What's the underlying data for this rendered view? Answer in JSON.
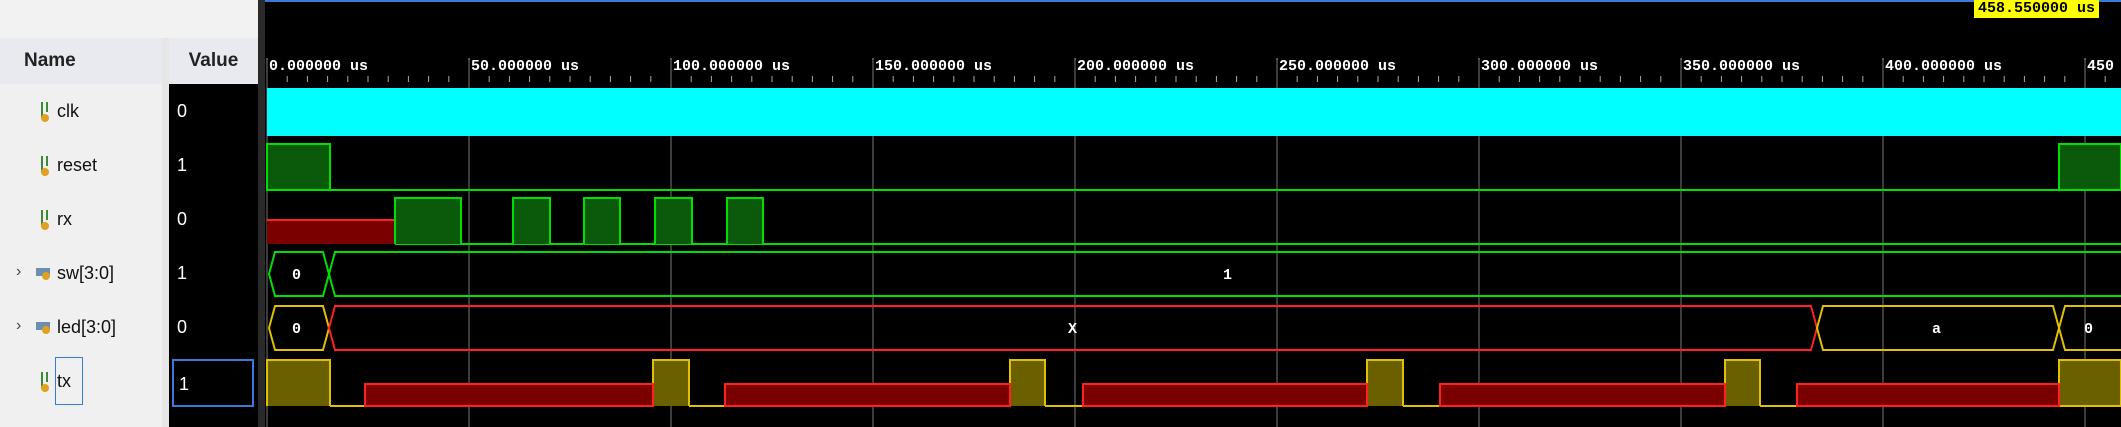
{
  "cursor": {
    "time_label": "458.550000 us"
  },
  "columns": {
    "name_header": "Name",
    "value_header": "Value"
  },
  "signals": [
    {
      "name": "clk",
      "value": "0",
      "icon": "bit-signal-icon",
      "expandable": false
    },
    {
      "name": "reset",
      "value": "1",
      "icon": "bit-signal-icon",
      "expandable": false
    },
    {
      "name": "rx",
      "value": "0",
      "icon": "bit-signal-icon",
      "expandable": false
    },
    {
      "name": "sw[3:0]",
      "value": "1",
      "icon": "bus-signal-icon",
      "expandable": true
    },
    {
      "name": "led[3:0]",
      "value": "0",
      "icon": "bus-signal-icon",
      "expandable": true
    },
    {
      "name": "tx",
      "value": "1",
      "icon": "bit-signal-icon",
      "expandable": false,
      "selected": true
    }
  ],
  "timeline": {
    "unit": "us",
    "tick_labels": [
      "0.000000 us",
      "50.000000 us",
      "100.000000 us",
      "150.000000 us",
      "200.000000 us",
      "250.000000 us",
      "300.000000 us",
      "350.000000 us",
      "400.000000 us",
      "450"
    ]
  },
  "waveforms": {
    "sw": {
      "segments": [
        "0",
        "1"
      ]
    },
    "led": {
      "segments": [
        "0",
        "X",
        "a",
        "0"
      ]
    }
  },
  "colors": {
    "clk": "#00ffff",
    "high_green": "#0b5a0b",
    "line_green": "#00e000",
    "unknown_red": "#7a0000",
    "line_red": "#ff2020",
    "tx_yellow": "#6b6000",
    "line_yellow": "#e0c000",
    "selection": "#3a7bd5",
    "cursor_bg": "#ffff00"
  }
}
